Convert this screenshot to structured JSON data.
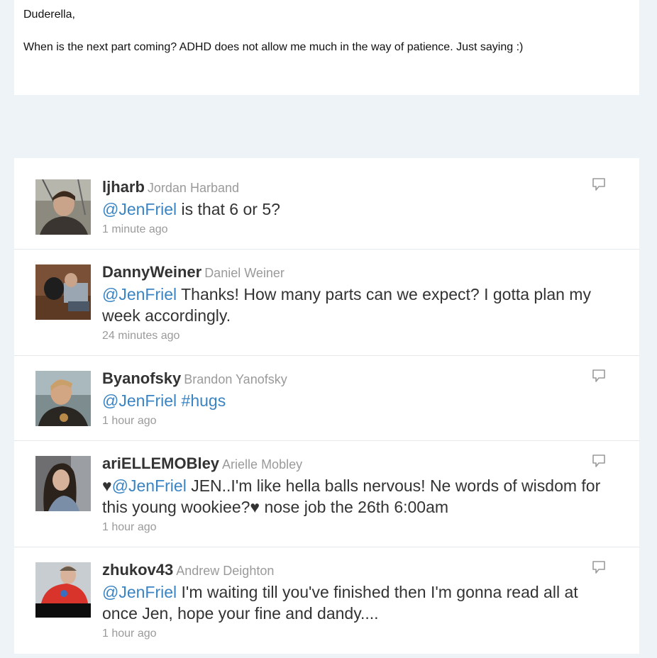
{
  "comment": {
    "greeting": "Duderella,",
    "body": "When is the next part coming?  ADHD does not allow me much in the way of patience.  Just saying :)"
  },
  "tweets": [
    {
      "handle": "ljharb",
      "name": "Jordan Harband",
      "prefix": "",
      "mention": "@JenFriel",
      "text": " is that 6 or 5?",
      "time": "1 minute ago",
      "avatar": "ljharb-avatar",
      "reply_icon": "reply-icon"
    },
    {
      "handle": "DannyWeiner",
      "name": "Daniel Weiner",
      "prefix": "",
      "mention": "@JenFriel",
      "text": " Thanks! How many parts can we expect? I gotta plan my week accordingly.",
      "time": "24 minutes ago",
      "avatar": "dannyweiner-avatar"
    },
    {
      "handle": "Byanofsky",
      "name": "Brandon Yanofsky",
      "prefix": "",
      "mention": "@JenFriel #hugs",
      "text": "",
      "time": "1 hour ago",
      "avatar": "byanofsky-avatar",
      "reply_icon": "reply-icon"
    },
    {
      "handle": "ariELLEMOBley",
      "name": "Arielle Mobley",
      "prefix": "♥",
      "mention": "@JenFriel",
      "text": " JEN..I'm like hella balls nervous! Ne words of wisdom for this young wookiee?♥ nose job the 26th 6:00am",
      "time": "1 hour ago",
      "avatar": "ariellemobley-avatar",
      "reply_icon": "reply-icon"
    },
    {
      "handle": "zhukov43",
      "name": "Andrew Deighton",
      "prefix": "",
      "mention": "@JenFriel",
      "text": " I'm waiting till you've finished then I'm gonna read all at once Jen, hope your fine and dandy....",
      "time": "1 hour ago",
      "avatar": "zhukov43-avatar",
      "reply_icon": "reply-icon"
    }
  ],
  "colors": {
    "background": "#eef3f7",
    "mention": "#3a84c3",
    "muted": "#9a9a9a"
  }
}
